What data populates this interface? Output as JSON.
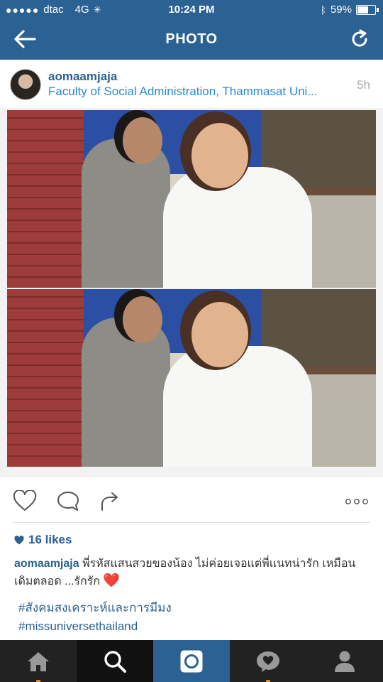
{
  "status_bar": {
    "signal_dots": "●●●●●",
    "carrier": "dtac",
    "network": "4G",
    "time": "10:24 PM",
    "battery_text": "59%",
    "battery_level": 0.59
  },
  "nav": {
    "title": "PHOTO",
    "back_icon": "arrow-left-icon",
    "refresh_icon": "refresh-icon"
  },
  "post": {
    "username": "aomaamjaja",
    "location": "Faculty of Social Administration, Thammasat Uni...",
    "time_ago": "5h",
    "likes": "16 likes",
    "caption_user": "aomaamjaja",
    "caption_text": "พี่รหัสแสนสวยของน้อง ไม่ค่อยเจอแต่พี่แนทน่ารัก เหมือนเดิมตลอด ...รักรัก",
    "caption_emoji": "❤️",
    "hashtags": [
      "#สังคมสงเคราะห์และการมีมง",
      "#missuniversethailand"
    ]
  },
  "actions": {
    "like_icon": "heart-outline-icon",
    "comment_icon": "comment-bubble-icon",
    "share_icon": "share-arrow-icon",
    "more_icon": "more-dots-icon"
  },
  "tabs": [
    {
      "name": "home",
      "icon": "home-icon"
    },
    {
      "name": "search",
      "icon": "search-icon"
    },
    {
      "name": "camera",
      "icon": "camera-icon"
    },
    {
      "name": "activity",
      "icon": "heart-bubble-icon"
    },
    {
      "name": "profile",
      "icon": "profile-icon"
    }
  ],
  "colors": {
    "brand_blue": "#2b6193",
    "link_blue": "#2b8ad0",
    "tab_bar": "#222222",
    "notification_orange": "#f08a24"
  }
}
